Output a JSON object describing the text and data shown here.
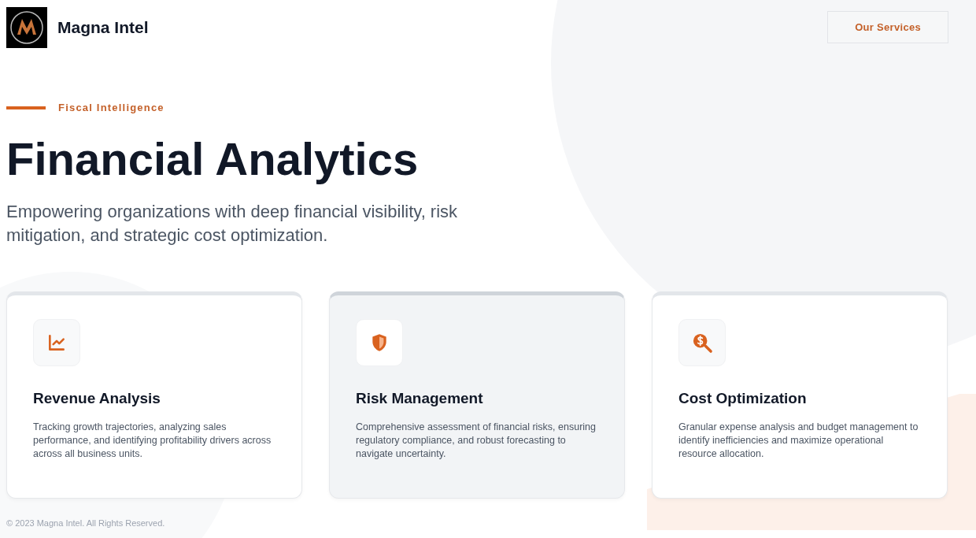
{
  "header": {
    "brand": "Magna Intel",
    "nav_button": "Our Services"
  },
  "hero": {
    "eyebrow": "Fiscal Intelligence",
    "title": "Financial Analytics",
    "subtitle": "Empowering organizations with deep financial visibility, risk mitigation, and strategic cost optimization."
  },
  "cards": [
    {
      "title": "Revenue Analysis",
      "text": "Tracking growth trajectories, analyzing sales performance, and identifying profitability drivers across across all business units.",
      "highlighted": false
    },
    {
      "title": "Risk Management",
      "text": "Comprehensive assessment of financial risks, ensuring regulatory compliance, and robust forecasting to navigate uncertainty.",
      "highlighted": true
    },
    {
      "title": "Cost Optimization",
      "text": "Granular expense analysis and budget management to identify inefficiencies and maximize operational resource allocation.",
      "highlighted": false
    }
  ],
  "footer": "© 2023 Magna Intel. All Rights Reserved."
}
